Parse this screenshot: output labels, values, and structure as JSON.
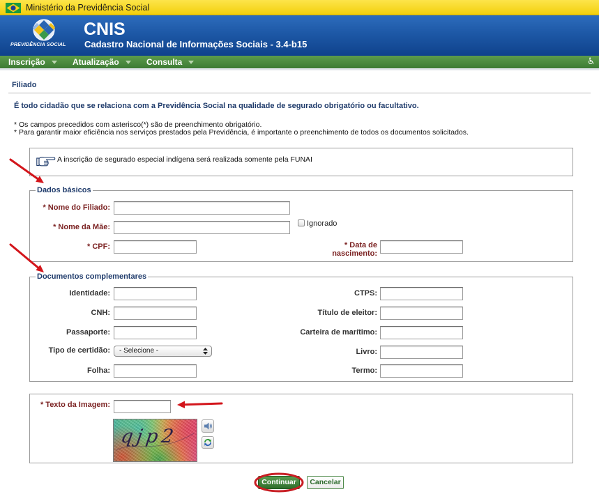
{
  "top_bar": {
    "title": "Ministério da Previdência Social",
    "flag_icon": "brazil-flag-icon"
  },
  "header": {
    "logo_icon": "previdencia-emblem-icon",
    "logo_text": "PREVIDÊNCIA SOCIAL",
    "app_name": "CNIS",
    "app_full_name": "Cadastro Nacional de Informações Sociais - 3.4-b15"
  },
  "nav": {
    "items": [
      {
        "label": "Inscrição",
        "icon": "caret-down-icon"
      },
      {
        "label": "Atualização",
        "icon": "caret-down-icon"
      },
      {
        "label": "Consulta",
        "icon": "caret-down-icon"
      }
    ],
    "accessibility_icon": "wheelchair-icon"
  },
  "section": {
    "title": "Filiado",
    "description": "É todo cidadão que se relaciona com a Previdência Social na qualidade de segurado obrigatório ou facultativo.",
    "notes": [
      "* Os campos precedidos com asterisco(*) são de preenchimento obrigatório.",
      "* Para garantir maior eficiência nos serviços prestados pela Previdência, é importante o preenchimento de todos os documentos solicitados."
    ]
  },
  "info_box": {
    "icon": "pointing-hand-icon",
    "text": "A inscrição de segurado especial indígena será realizada somente pela FUNAI"
  },
  "dados_basicos": {
    "legend": "Dados básicos",
    "nome_filiado": {
      "label": "* Nome do Filiado:",
      "value": ""
    },
    "nome_mae": {
      "label": "* Nome da Mãe:",
      "value": ""
    },
    "ignorado": {
      "label": "Ignorado",
      "checked": false
    },
    "cpf": {
      "label": "* CPF:",
      "value": ""
    },
    "data_nascimento": {
      "label": "* Data de nascimento:",
      "value": ""
    }
  },
  "documentos_complementares": {
    "legend": "Documentos complementares",
    "identidade": {
      "label": "Identidade:",
      "value": ""
    },
    "ctps": {
      "label": "CTPS:",
      "value": ""
    },
    "cnh": {
      "label": "CNH:",
      "value": ""
    },
    "titulo_eleitor": {
      "label": "Título de eleitor:",
      "value": ""
    },
    "passaporte": {
      "label": "Passaporte:",
      "value": ""
    },
    "carteira_maritimo": {
      "label": "Carteira de marítimo:",
      "value": ""
    },
    "tipo_certidao": {
      "label": "Tipo de certidão:",
      "selected": "- Selecione -",
      "icon": "select-arrows-icon"
    },
    "livro": {
      "label": "Livro:",
      "value": ""
    },
    "folha": {
      "label": "Folha:",
      "value": ""
    },
    "termo": {
      "label": "Termo:",
      "value": ""
    }
  },
  "captcha": {
    "label": "* Texto da Imagem:",
    "value": "",
    "image_text": "qjp2",
    "audio_icon": "speaker-icon",
    "refresh_icon": "refresh-icon"
  },
  "actions": {
    "continue_label": "Continuar",
    "cancel_label": "Cancelar"
  },
  "colors": {
    "top_bar": "#f3cf0b",
    "header_blue": "#1d58a6",
    "nav_green": "#4a8a3f",
    "title_navy": "#1f3b6b",
    "required_label": "#7b2222",
    "continue_button": "#3f7f39",
    "annotation_red": "#d3151b"
  }
}
